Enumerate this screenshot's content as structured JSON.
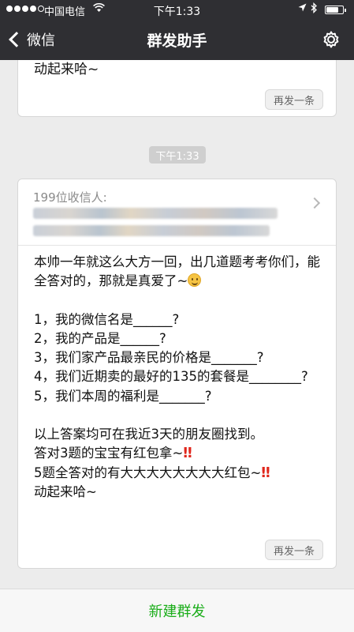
{
  "status_bar": {
    "carrier": "中国电信",
    "time": "下午1:33"
  },
  "nav": {
    "back_label": "微信",
    "title": "群发助手",
    "settings_icon": "gear-icon"
  },
  "top_card": {
    "tail_text": "动起来哈~",
    "resend_label": "再发一条"
  },
  "time_divider": "下午1:33",
  "main_card": {
    "recipients_label": "199位收信人:",
    "lines": {
      "intro": "本帅一年就这么大方一回，出几道题考考你们，能全答对的，那就是真爱了~",
      "q1": "1，我的微信名是______?",
      "q2": "2，我的产品是______?",
      "q3": "3，我们家产品最亲民的价格是_______?",
      "q4": "4，我们近期卖的最好的135的套餐是________?",
      "q5": "5，我们本周的福利是_______?",
      "a1": "以上答案均可在我近3天的朋友圈找到。",
      "a2": "答对3题的宝宝有红包拿~",
      "a3": "5题全答对的有大大大大大大大大红包~",
      "a4": "动起来哈~"
    },
    "bang": "‼",
    "resend_label": "再发一条"
  },
  "bottom": {
    "new_broadcast_label": "新建群发"
  },
  "colors": {
    "nav_bg": "#2f2f33",
    "accent_green": "#1aad19",
    "page_bg": "#ececec"
  }
}
